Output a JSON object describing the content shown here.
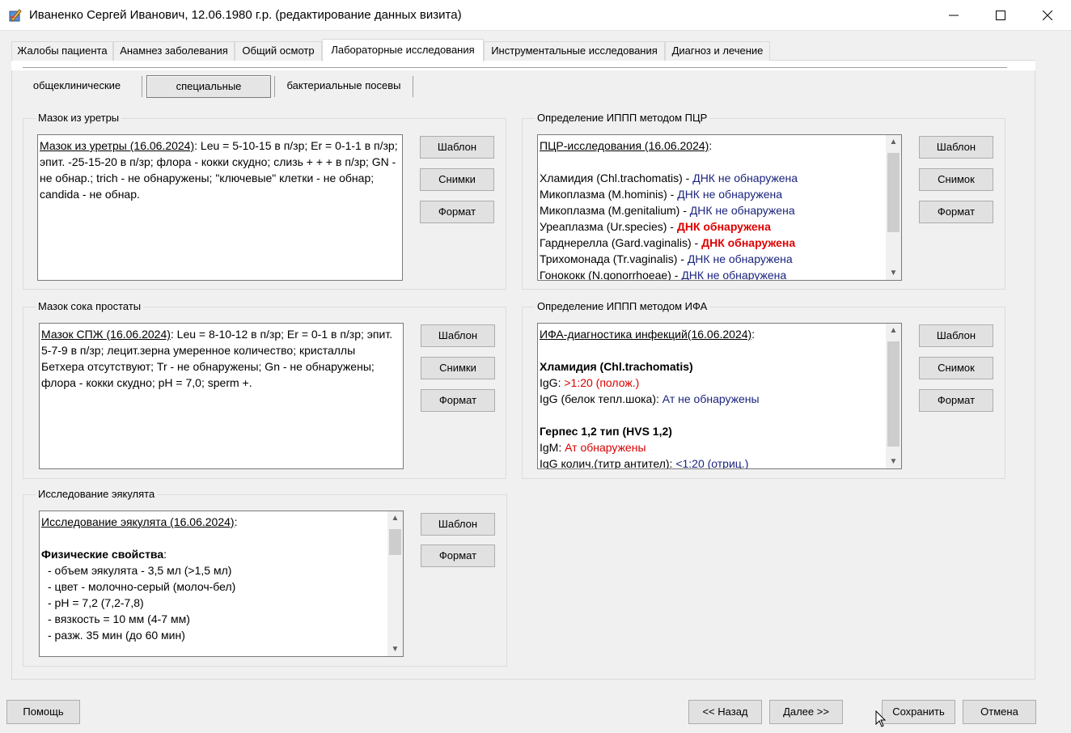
{
  "window": {
    "title": "Иваненко Сергей Иванович, 12.06.1980 г.р. (редактирование данных визита)",
    "controls": [
      "—",
      "☐",
      "✕"
    ]
  },
  "main_tabs": [
    "Жалобы пациента",
    "Анамнез заболевания",
    "Общий осмотр",
    "Лабораторные исследования",
    "Инструментальные исследования",
    "Диагноз и лечение"
  ],
  "sub_tabs": [
    "общеклинические",
    "специальные",
    "бактериальные посевы"
  ],
  "urethra": {
    "group": "Мазок из уретры",
    "heading": "Мазок из уретры (16.06.2024)",
    "text": ": Leu = 5-10-15 в п/зр; Er = 0-1-1 в п/зр; эпит. -25-15-20 в п/зр; флора - кокки скудно; слизь + + + в п/зр; GN - не обнар.; trich - не обнаружены; \"ключевые\" клетки - не обнар; candida - не обнар.",
    "buttons": [
      "Шаблон",
      "Снимки",
      "Формат"
    ]
  },
  "prostate": {
    "group": "Мазок сока простаты",
    "heading": "Мазок СПЖ (16.06.2024)",
    "text": ": Leu = 8-10-12 в п/зр; Er = 0-1 в п/зр; эпит. 5-7-9 в п/зр; лецит.зерна умеренное количество; кристаллы Бетхера отсутствуют; Tr - не обнаружены; Gn - не обнаружены; флора - кокки скудно; pH = 7,0; sperm +.",
    "buttons": [
      "Шаблон",
      "Снимки",
      "Формат"
    ]
  },
  "ejaculate": {
    "group": "Исследование эякулята",
    "heading": "Исследование эякулята (16.06.2024)",
    "heading_suffix": ":",
    "section": "Физические свойства",
    "section_suffix": ":",
    "lines": [
      "- объем эякулята - 3,5 мл (>1,5 мл)",
      "- цвет - молочно-серый (молоч-бел)",
      "- pH = 7,2 (7,2-7,8)",
      "- вязкость = 10 мм (4-7 мм)",
      "- разж. 35 мин (до 60 мин)"
    ],
    "buttons": [
      "Шаблон",
      "Формат"
    ]
  },
  "pcr": {
    "group": "Определение ИППП методом ПЦР",
    "heading": "ПЦР-исследования (16.06.2024)",
    "heading_suffix": ":",
    "rows": [
      {
        "name": "Хламидия (Chl.trachomatis) - ",
        "result": "ДНК не обнаружена",
        "status": "negative"
      },
      {
        "name": "Микоплазма (M.hominis) - ",
        "result": "ДНК не обнаружена",
        "status": "negative"
      },
      {
        "name": "Микоплазма (M.genitalium) - ",
        "result": "ДНК не обнаружена",
        "status": "negative"
      },
      {
        "name": "Уреаплазма (Ur.species) - ",
        "result": "ДНК обнаружена",
        "status": "positive"
      },
      {
        "name": "Гарднерелла (Gard.vaginalis) - ",
        "result": "ДНК обнаружена",
        "status": "positive"
      },
      {
        "name": "Трихомонада (Tr.vaginalis) - ",
        "result": "ДНК не обнаружена",
        "status": "negative"
      },
      {
        "name": "Гонококк (N.gonorrhoeae) - ",
        "result": "ДНК не обнаружена",
        "status": "negative"
      }
    ],
    "buttons": [
      "Шаблон",
      "Снимок",
      "Формат"
    ]
  },
  "ifa": {
    "group": "Определение ИППП методом ИФА",
    "heading": "ИФА-диагностика инфекций(16.06.2024)",
    "heading_suffix": ":",
    "block1_title": "Хламидия (Chl.trachomatis)",
    "block1_l1_label": "IgG: ",
    "block1_l1_value": ">1:20 (полож.)",
    "block1_l2_label": "IgG (белок тепл.шока): ",
    "block1_l2_value": "Ат не обнаружены",
    "block2_title": "Герпес 1,2 тип (HVS 1,2)",
    "block2_l1_label": "IgM: ",
    "block2_l1_value": "Ат обнаружены",
    "block2_l2_label": "IgG колич.(титр антител): ",
    "block2_l2_value": "<1:20 (отриц.)",
    "buttons": [
      "Шаблон",
      "Снимок",
      "Формат"
    ]
  },
  "footer": {
    "help": "Помощь",
    "back": "<< Назад",
    "next": "Далее >>",
    "save": "Сохранить",
    "cancel": "Отмена"
  },
  "colors": {
    "negative": "#1a237e",
    "positive": "#e00000",
    "accent": "#0078d7"
  }
}
